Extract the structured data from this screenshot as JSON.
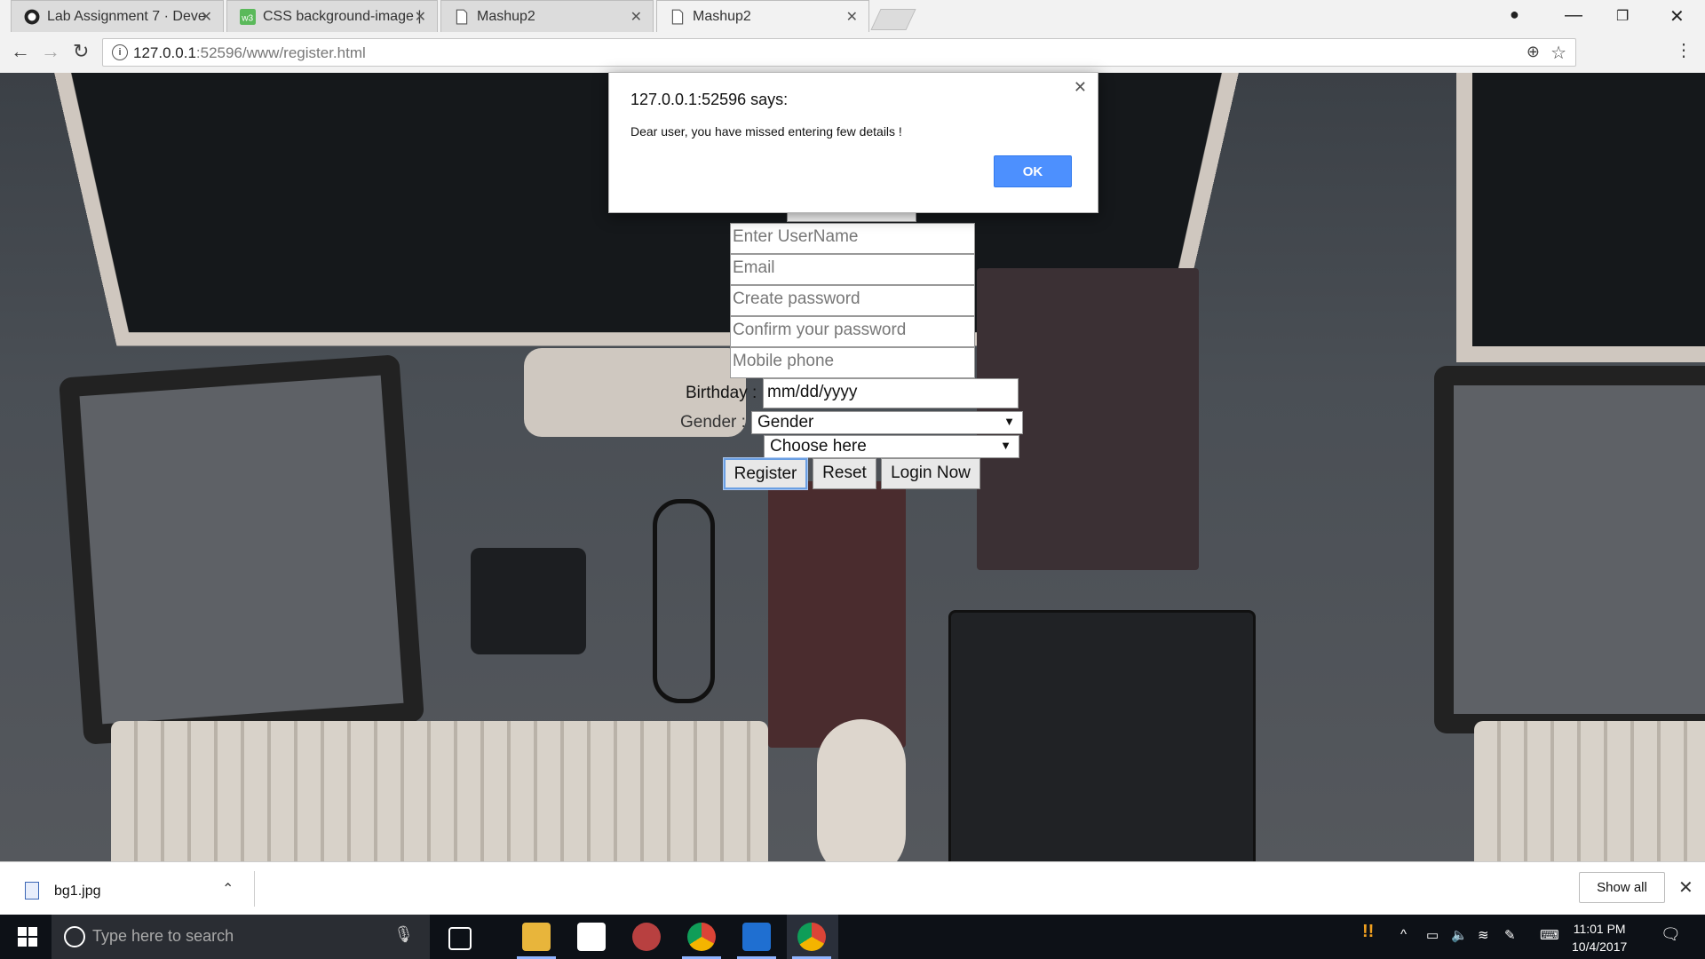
{
  "browser": {
    "tabs": [
      {
        "label": "Lab Assignment 7 · Deve",
        "icon": "github-icon",
        "active": false
      },
      {
        "label": "CSS background-image |",
        "icon": "w3-icon",
        "active": false
      },
      {
        "label": "Mashup2",
        "icon": "page-icon",
        "active": false
      },
      {
        "label": "Mashup2",
        "icon": "page-icon",
        "active": true
      }
    ],
    "url_host": "127.0.0.1",
    "url_rest": ":52596/www/register.html"
  },
  "form": {
    "username_placeholder": "Enter UserName",
    "email_placeholder": "Email",
    "password_placeholder": "Create password",
    "confirm_placeholder": "Confirm your password",
    "mobile_placeholder": "Mobile phone",
    "birthday_label": "Birthday :",
    "birthday_value": "mm/dd/yyyy",
    "gender_label": "Gender :",
    "gender_value": "Gender",
    "location_value": "Choose here",
    "register_label": "Register",
    "reset_label": "Reset",
    "login_label": "Login Now"
  },
  "dialog": {
    "title": "127.0.0.1:52596 says:",
    "message": "Dear user, you have missed entering few details !",
    "ok_label": "OK"
  },
  "downloads": {
    "filename": "bg1.jpg",
    "show_all_label": "Show all"
  },
  "taskbar": {
    "search_placeholder": "Type here to search",
    "time": "11:01 PM",
    "date": "10/4/2017"
  },
  "colors": {
    "dialog_ok": "#4d90fe",
    "register_focus": "#6a9fe3"
  }
}
